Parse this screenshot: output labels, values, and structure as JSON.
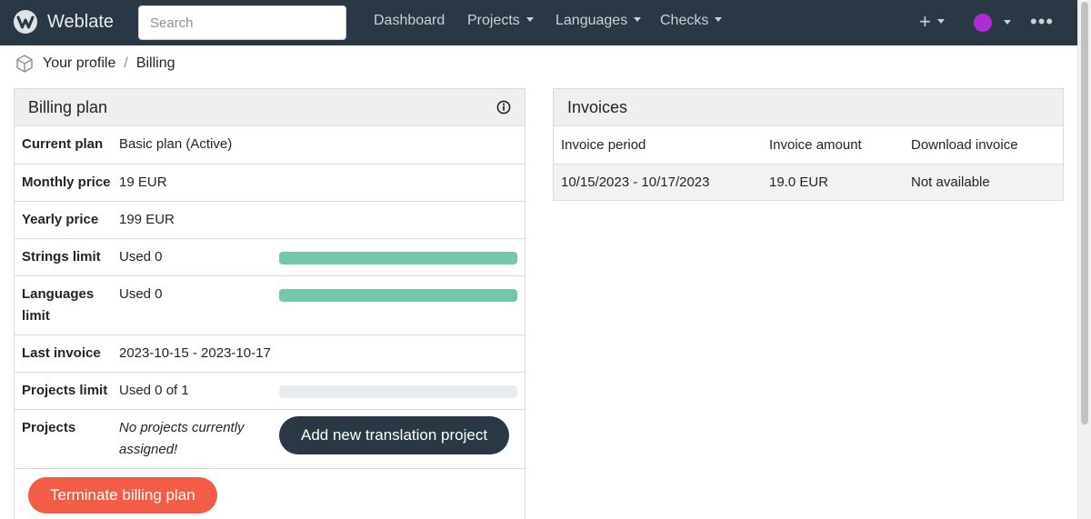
{
  "navbar": {
    "brand": "Weblate",
    "search_placeholder": "Search",
    "links": [
      {
        "label": "Dashboard",
        "dropdown": false
      },
      {
        "label": "Projects",
        "dropdown": true
      },
      {
        "label": "Languages",
        "dropdown": true
      },
      {
        "label": "Checks",
        "dropdown": true
      }
    ],
    "add_label": "+",
    "more_label": "•••"
  },
  "breadcrumb": {
    "items": [
      "Your profile",
      "Billing"
    ],
    "separator": "/"
  },
  "billing": {
    "heading": "Billing plan",
    "rows": {
      "current_plan": {
        "label": "Current plan",
        "value": "Basic plan (Active)"
      },
      "monthly_price": {
        "label": "Monthly price",
        "value": "19 EUR"
      },
      "yearly_price": {
        "label": "Yearly price",
        "value": "199 EUR"
      },
      "strings_limit": {
        "label": "Strings limit",
        "value": "Used 0",
        "usage": 1.0
      },
      "languages_limit": {
        "label": "Languages limit",
        "value": "Used 0",
        "usage": 1.0
      },
      "last_invoice": {
        "label": "Last invoice",
        "value": "2023-10-15 - 2023-10-17"
      },
      "projects_limit": {
        "label": "Projects limit",
        "value": "Used 0 of 1",
        "usage": 0.0
      },
      "projects": {
        "label": "Projects",
        "value": "No projects currently assigned!"
      }
    },
    "add_project_button": "Add new translation project",
    "terminate_button": "Terminate billing plan"
  },
  "invoices": {
    "heading": "Invoices",
    "columns": [
      "Invoice period",
      "Invoice amount",
      "Download invoice"
    ],
    "rows": [
      [
        "10/15/2023 - 10/17/2023",
        "19.0 EUR",
        "Not available"
      ]
    ]
  },
  "colors": {
    "navbar": "#2a3744",
    "progress": "#74c6ad",
    "danger": "#f35c46",
    "panel_heading": "#efefef"
  }
}
